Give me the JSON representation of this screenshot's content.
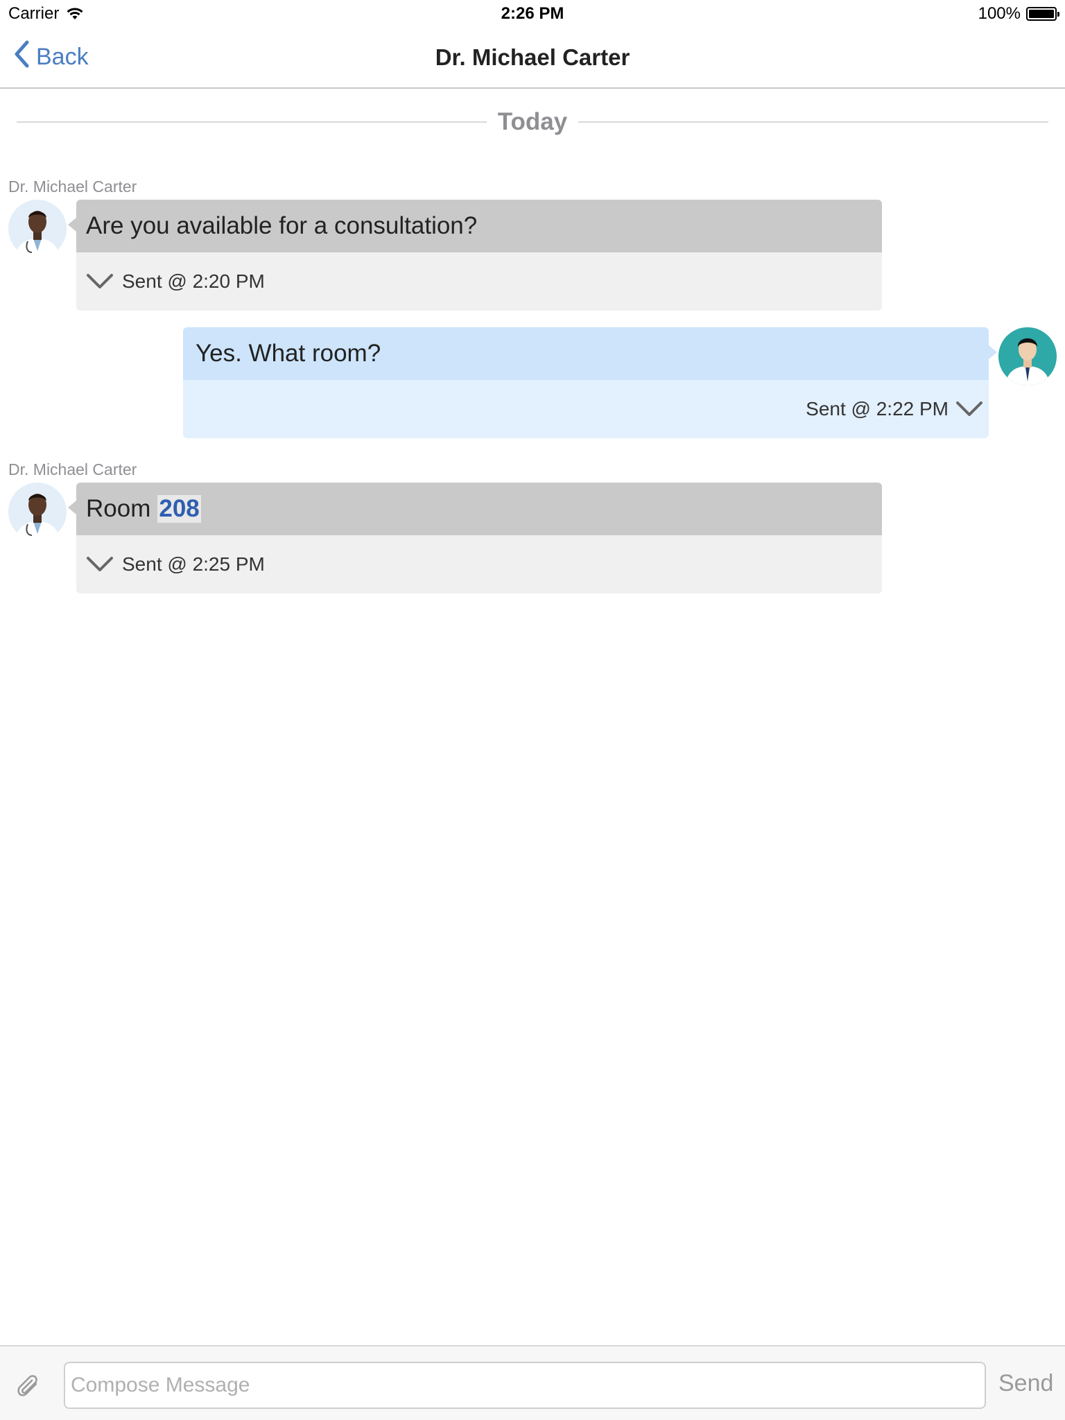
{
  "status_bar": {
    "carrier": "Carrier",
    "time": "2:26 PM",
    "battery": "100%",
    "battery_level": 1.0
  },
  "nav": {
    "back_label": "Back",
    "title": "Dr. Michael Carter"
  },
  "divider": {
    "label": "Today"
  },
  "messages": [
    {
      "direction": "incoming",
      "sender": "Dr. Michael Carter",
      "text": "Are you available for a consultation?",
      "sent": "Sent @ 2:20 PM"
    },
    {
      "direction": "outgoing",
      "text": "Yes. What room?",
      "sent": "Sent @ 2:22 PM"
    },
    {
      "direction": "incoming",
      "sender": "Dr. Michael Carter",
      "text": "Room",
      "highlight": "208",
      "sent": "Sent @ 2:25 PM"
    }
  ],
  "compose": {
    "placeholder": "Compose Message",
    "value": "",
    "send_label": "Send"
  },
  "colors": {
    "accent": "#4a7ec2",
    "incoming_body": "#c9c9c9",
    "incoming_footer": "#f0f0f0",
    "outgoing_body": "#cde4fb",
    "outgoing_footer": "#e3f0fd",
    "highlight_text": "#2f5fb0"
  },
  "icons": {
    "wifi": "wifi-icon",
    "battery": "battery-icon",
    "back": "chevron-left-icon",
    "expand": "chevron-down-icon",
    "attach": "paperclip-icon"
  }
}
